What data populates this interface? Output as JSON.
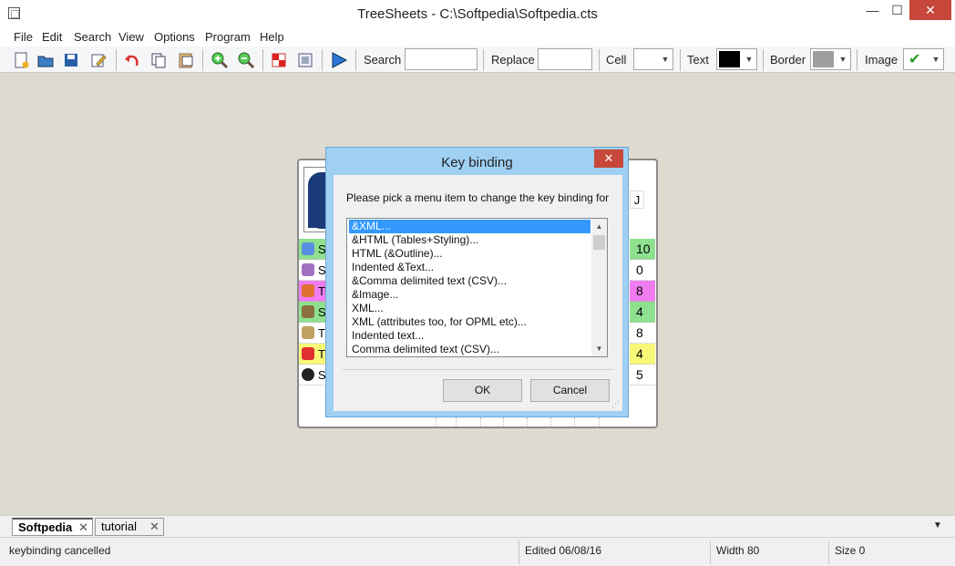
{
  "window": {
    "title": "TreeSheets - C:\\Softpedia\\Softpedia.cts",
    "min": "—",
    "max": "☐",
    "close": "✕"
  },
  "menu": [
    "File",
    "Edit",
    "Search",
    "View",
    "Options",
    "Program",
    "Help"
  ],
  "toolbar": {
    "search_label": "Search",
    "search_value": "",
    "replace_label": "Replace",
    "replace_value": "",
    "cell_label": "Cell",
    "text_label": "Text",
    "text_color": "#000000",
    "border_label": "Border",
    "border_color": "#9e9e9e",
    "image_label": "Image",
    "image_check": "✔"
  },
  "grid": {
    "rows_left": [
      "S",
      "S",
      "T",
      "S",
      "T",
      "T",
      "S"
    ],
    "row_colors": [
      "#8ee08e",
      "#ffffff",
      "#f07cf0",
      "#8ee08e",
      "#ffffff",
      "#f8f878",
      "#ffffff"
    ],
    "rows_right": [
      "10",
      "0",
      "8",
      "4",
      "8",
      "4",
      "5"
    ],
    "j_cell": "J"
  },
  "dialog": {
    "title": "Key binding",
    "close": "✕",
    "prompt": "Please pick a menu item to change the key binding for",
    "items": [
      "&XML...",
      "&HTML (Tables+Styling)...",
      "HTML (&Outline)...",
      "Indented &Text...",
      "&Comma delimited text (CSV)...",
      "&Image...",
      "XML...",
      "XML (attributes too, for OPML etc)...",
      "Indented text...",
      "Comma delimited text (CSV)..."
    ],
    "selected_index": 0,
    "ok": "OK",
    "cancel": "Cancel"
  },
  "tabs": [
    {
      "label": "Softpedia",
      "active": true,
      "close": "✕"
    },
    {
      "label": "tutorial",
      "active": false,
      "close": "✕"
    }
  ],
  "tab_dropdown": "▼",
  "status": {
    "message": "keybinding cancelled",
    "edited": "Edited 06/08/16",
    "width": "Width 80",
    "size": "Size 0"
  }
}
